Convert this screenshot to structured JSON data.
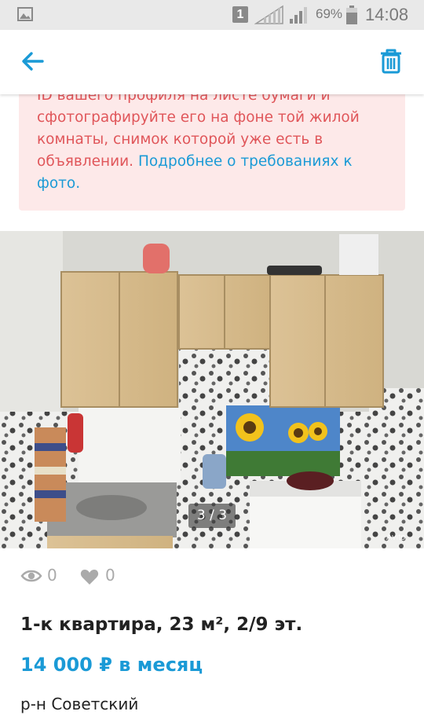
{
  "status_bar": {
    "sim_label": "1",
    "battery_percent": "69%",
    "time": "14:08",
    "icons": [
      "image-icon",
      "sim-icon",
      "signal-icon",
      "signal-icon",
      "battery-icon"
    ]
  },
  "app_bar": {
    "back_icon": "arrow-left-icon",
    "delete_icon": "trash-icon",
    "accent_color": "#1a9ad6"
  },
  "warning": {
    "line_clipped": "ID вашего профиля на листе бумаги и",
    "body": "сфотографируйте его на фоне той жилой комнаты, снимок которой уже есть в объявлении.",
    "link_text": "Подробнее о требованиях к фото.",
    "background_color": "#fde9e9",
    "text_color": "#e0565a"
  },
  "photo": {
    "counter": "3 / 3",
    "watermark": "Avito"
  },
  "stats": {
    "views": "0",
    "favorites": "0"
  },
  "listing": {
    "title": "1-к квартира, 23 м², 2/9 эт.",
    "price": "14 000 ₽ в месяц",
    "district": "р-н Советский"
  }
}
